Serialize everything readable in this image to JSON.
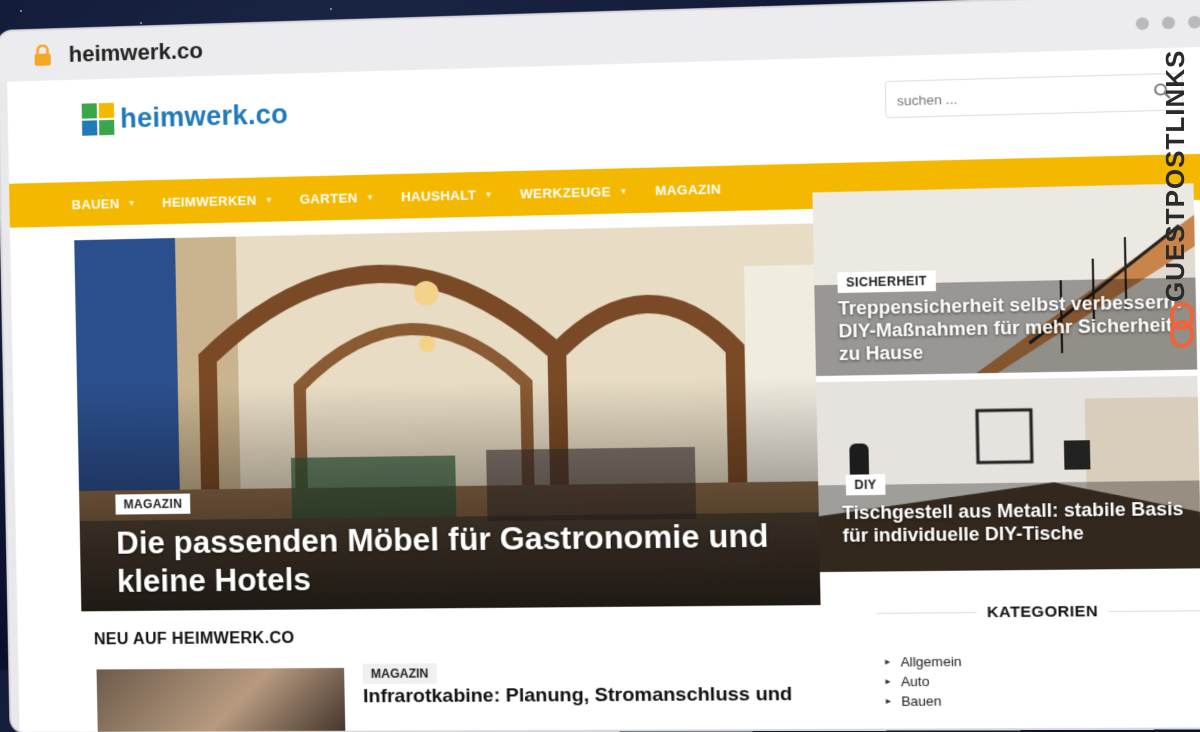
{
  "browser": {
    "url": "heimwerk.co"
  },
  "site": {
    "logo_text": "heimwerk.co"
  },
  "search": {
    "placeholder": "suchen ..."
  },
  "nav": {
    "items": [
      {
        "label": "BAUEN",
        "has_dropdown": true
      },
      {
        "label": "HEIMWERKEN",
        "has_dropdown": true
      },
      {
        "label": "GARTEN",
        "has_dropdown": true
      },
      {
        "label": "HAUSHALT",
        "has_dropdown": true
      },
      {
        "label": "WERKZEUGE",
        "has_dropdown": true
      },
      {
        "label": "MAGAZIN",
        "has_dropdown": false
      }
    ]
  },
  "hero": {
    "category": "MAGAZIN",
    "title": "Die passenden Möbel für Gastronomie und kleine Hotels"
  },
  "side_posts": [
    {
      "category": "SICHERHEIT",
      "title": "Treppensicherheit selbst verbessern: DIY-Maßnahmen für mehr Sicherheit zu Hause"
    },
    {
      "category": "DIY",
      "title": "Tischgestell aus Metall: stabile Basis für individuelle DIY-Tische"
    }
  ],
  "latest": {
    "heading": "NEU AUF HEIMWERK.CO",
    "first_post": {
      "category": "MAGAZIN",
      "title": "Infrarotkabine: Planung, Stromanschluss und"
    }
  },
  "categories": {
    "heading": "KATEGORIEN",
    "items": [
      "Allgemein",
      "Auto",
      "Bauen"
    ]
  },
  "badge": {
    "text": "GUESTPOSTLINKS"
  },
  "colors": {
    "nav": "#f5b800",
    "logo": "#1f7ab8",
    "badge_accent": "#f0643c"
  }
}
